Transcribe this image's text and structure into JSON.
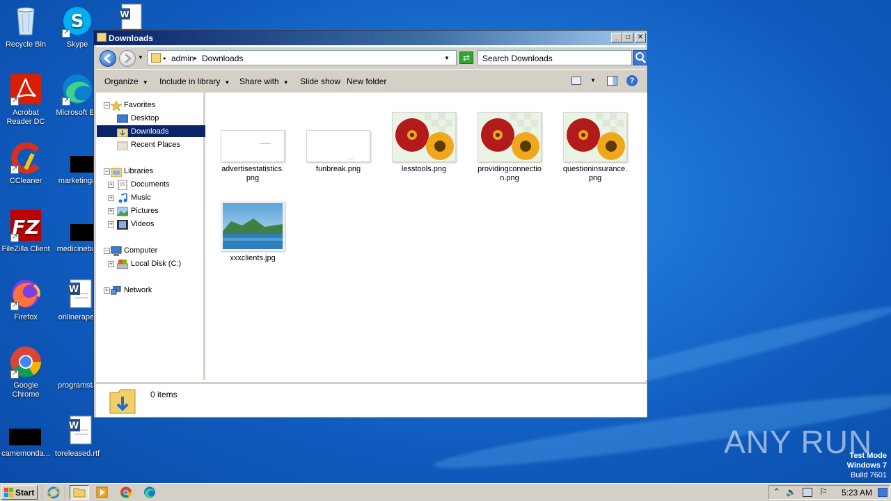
{
  "desktop": {
    "icons": [
      {
        "label": "Recycle Bin"
      },
      {
        "label": "Skype"
      },
      {
        "label": "Acrobat Reader DC"
      },
      {
        "label": "Microsoft Ed"
      },
      {
        "label": "CCleaner"
      },
      {
        "label": "marketinga"
      },
      {
        "label": "FileZilla Client"
      },
      {
        "label": "medicinebal"
      },
      {
        "label": "Firefox"
      },
      {
        "label": "onlinerape."
      },
      {
        "label": "Google Chrome"
      },
      {
        "label": "programsta"
      },
      {
        "label": "camemonda..."
      },
      {
        "label": "toreleased.rtf"
      }
    ]
  },
  "window": {
    "title": "Downloads",
    "controls": {
      "minimize": "_",
      "maximize": "□",
      "close": "✕"
    }
  },
  "address": {
    "segments": [
      "admin",
      "Downloads"
    ]
  },
  "search": {
    "placeholder": "Search Downloads"
  },
  "toolbar": {
    "organize": "Organize",
    "include": "Include in library",
    "share": "Share with",
    "slideshow": "Slide show",
    "newfolder": "New folder"
  },
  "navpane": {
    "favorites": "Favorites",
    "desktop": "Desktop",
    "downloads": "Downloads",
    "recent": "Recent Places",
    "libraries": "Libraries",
    "documents": "Documents",
    "music": "Music",
    "pictures": "Pictures",
    "videos": "Videos",
    "computer": "Computer",
    "localdisk": "Local Disk (C:)",
    "network": "Network"
  },
  "files": [
    {
      "name": "advertisestatistics.png",
      "name1": "advertisestatistics.",
      "name2": "png",
      "thumb": "blank"
    },
    {
      "name": "funbreak.png",
      "name1": "funbreak.png",
      "name2": "",
      "thumb": "blank"
    },
    {
      "name": "lesstools.png",
      "name1": "lesstools.png",
      "name2": "",
      "thumb": "flowers"
    },
    {
      "name": "providingconnection.png",
      "name1": "providingconnectio",
      "name2": "n.png",
      "thumb": "flowers"
    },
    {
      "name": "questioninsurance.png",
      "name1": "questioninsurance.",
      "name2": "png",
      "thumb": "flowers"
    },
    {
      "name": "xxxclients.jpg",
      "name1": "xxxclients.jpg",
      "name2": "",
      "thumb": "landscape"
    }
  ],
  "details": {
    "count": "0 items"
  },
  "taskbar": {
    "start": "Start",
    "clock": "5:23 AM"
  },
  "watermark": "ANY RUN",
  "testmode": {
    "line1": "Test Mode",
    "line2": "Windows 7",
    "line3": "Build 7601"
  },
  "colors": {
    "desktop": "#1a6fd0",
    "selection": "#0a246a",
    "chrome": "#d4d0c8"
  }
}
